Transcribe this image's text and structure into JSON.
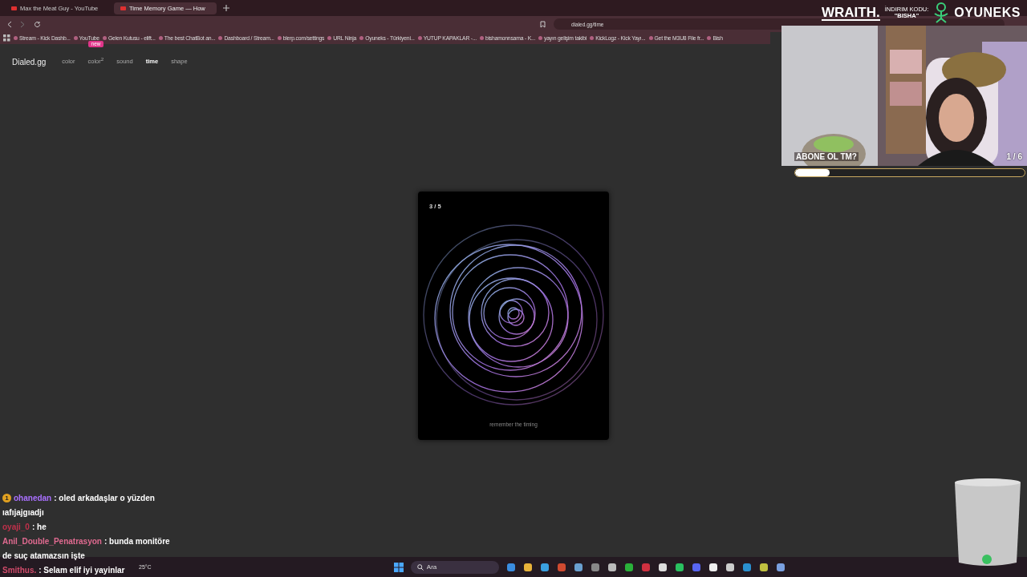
{
  "browser": {
    "tabs": [
      {
        "title": "Max the Meat Guy - YouTube",
        "selected": false
      },
      {
        "title": "Time Memory Game — How",
        "selected": true
      }
    ],
    "address": "dialed.gg/time",
    "bookmarks": [
      "Stream - Kick Dashb...",
      "YouTube",
      "Gelen Kutusu - elift...",
      "The best ChatBot an...",
      "Dashboard / Stream...",
      "blerp.com/settings",
      "URL Ninja",
      "Oyuneks - Türkiyeni...",
      "YUTUP KAPAKLAR -...",
      "bishamonnsama - K...",
      "yayın gelişim takibi",
      "KickLogz - Kick Yayı...",
      "Get the M3U8 File fr...",
      "Bish"
    ]
  },
  "site": {
    "logo": "Dialed.gg",
    "nav": [
      {
        "label": "color",
        "selected": false
      },
      {
        "label": "color$^{2}$",
        "selected": false,
        "badge": "new"
      },
      {
        "label": "sound",
        "selected": false
      },
      {
        "label": "time",
        "selected": true
      },
      {
        "label": "shape",
        "selected": false
      }
    ]
  },
  "card": {
    "counter": "3 / 5",
    "caption": "remember the timing"
  },
  "overlay": {
    "sponsor": "WRAITH.",
    "promo_label": "İNDIRIM KODU:",
    "promo_code": "\"BISHA\"",
    "brand": "OYUNEKS",
    "poll": {
      "question": "ABONE OL TM?",
      "count": "1 / 6",
      "level": 0.15
    }
  },
  "chat": [
    {
      "user": "ohanedan",
      "color": "#a970ff",
      "text": ": oled arkadaşlar o yüzden",
      "badge": "1"
    },
    {
      "text": "ıafıjajgıadjı"
    },
    {
      "user": "oyaji_0",
      "color": "#c0304a",
      "text": ": he"
    },
    {
      "user": "Anil_Double_Penatrasyon",
      "color": "#e06a90",
      "text": ": bunda monitöre"
    },
    {
      "text": "de suç atamazsın işte"
    },
    {
      "user": "Smithus.",
      "color": "#d04a6a",
      "text": ": Selam elif iyi yayinlar"
    }
  ],
  "taskbar": {
    "search_placeholder": "Ara",
    "weather": "25°C"
  }
}
